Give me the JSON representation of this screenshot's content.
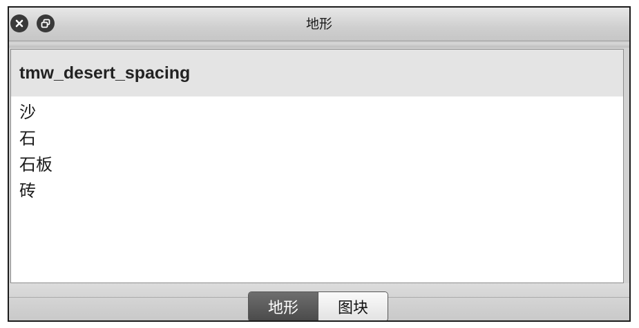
{
  "window": {
    "title": "地形",
    "buttons": {
      "close_icon": "close-icon",
      "float_icon": "float-icon"
    }
  },
  "tileset": {
    "name": "tmw_desert_spacing",
    "terrains": [
      {
        "label": "沙"
      },
      {
        "label": "石"
      },
      {
        "label": "石板"
      },
      {
        "label": "砖"
      }
    ]
  },
  "tabs": [
    {
      "label": "地形",
      "active": true
    },
    {
      "label": "图块",
      "active": false
    }
  ]
}
